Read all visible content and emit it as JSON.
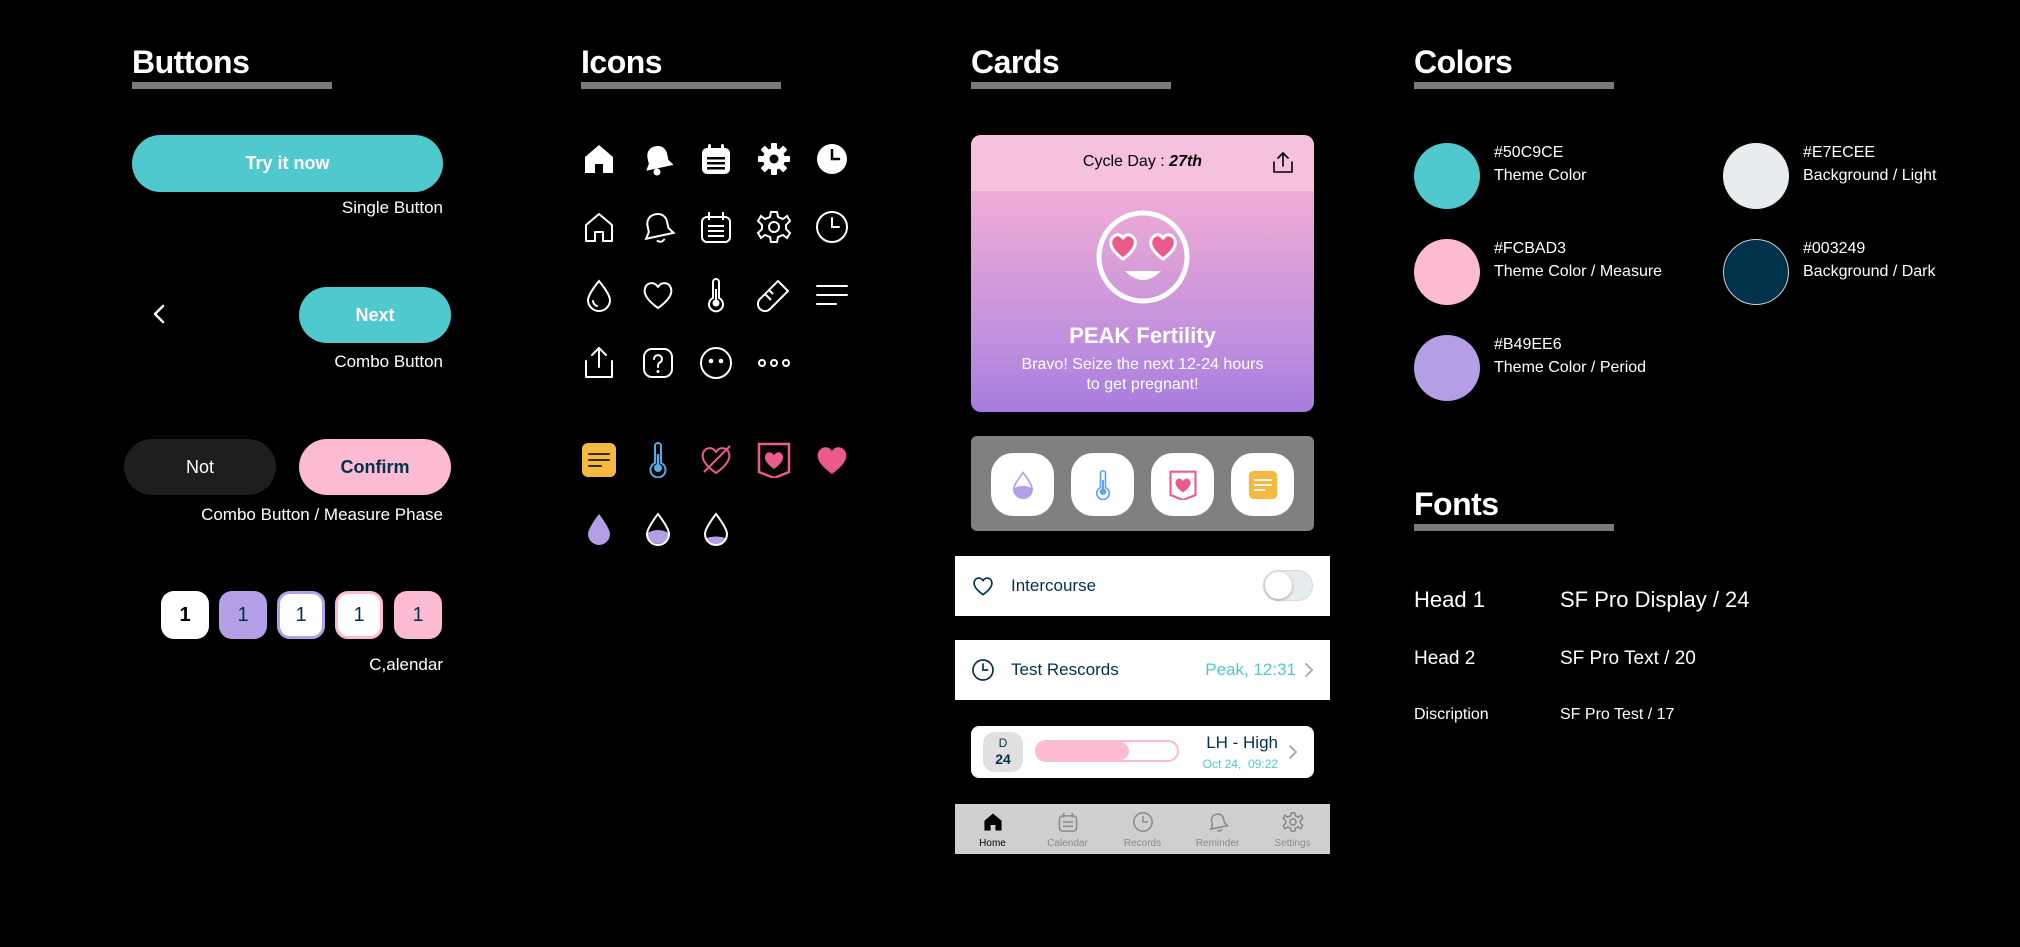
{
  "buttons": {
    "title": "Buttons",
    "single": {
      "label": "Try it now",
      "caption": "Single Button"
    },
    "combo": {
      "back_icon": "chevron-left-icon",
      "label": "Next",
      "caption": "Combo Button"
    },
    "measure": {
      "not_label": "Not",
      "confirm_label": "Confirm",
      "caption": "Combo Button / Measure Phase"
    },
    "calendar": {
      "days": [
        "1",
        "1",
        "1",
        "1",
        "1"
      ],
      "caption": "C,alendar"
    }
  },
  "icons": {
    "title": "Icons",
    "rows": [
      [
        "home-filled-icon",
        "bell-filled-icon",
        "calendar-filled-icon",
        "gear-filled-icon",
        "clock-filled-icon"
      ],
      [
        "home-outline-icon",
        "bell-outline-icon",
        "calendar-outline-icon",
        "gear-outline-icon",
        "clock-outline-icon"
      ],
      [
        "drop-icon",
        "heart-icon",
        "thermometer-icon",
        "test-tube-icon",
        "menu-icon"
      ],
      [
        "share-icon",
        "help-icon",
        "face-icon",
        "more-icon"
      ]
    ],
    "colored_rows": [
      [
        "note-yellow-icon",
        "thermometer-blue-icon",
        "heart-slash-pink-icon",
        "heart-badge-pink-icon",
        "heart-pink-icon"
      ],
      [
        "drop-full-purple-icon",
        "drop-half-purple-icon",
        "drop-low-purple-icon"
      ]
    ]
  },
  "cards": {
    "title": "Cards",
    "cycle": {
      "prefix": "Cycle Day : ",
      "day": "27th",
      "share_icon": "share-icon",
      "emoji": "heart-eyes-face-icon",
      "headline": "PEAK Fertility",
      "message_line1": "Bravo! Seize the next 12-24 hours",
      "message_line2": "to get pregnant!"
    },
    "quick_actions": [
      "drop-half-icon",
      "thermometer-icon",
      "heart-badge-icon",
      "note-icon"
    ],
    "intercourse": {
      "icon": "heart-outline-icon",
      "label": "Intercourse",
      "toggle_on": false
    },
    "test_records": {
      "icon": "clock-outline-icon",
      "label": "Test Rescords",
      "value": "Peak, 12:31"
    },
    "lh": {
      "day_letter": "D",
      "day_number": "24",
      "level_label": "LH - High",
      "date": "Oct 24,  09:22",
      "progress": 0.66
    },
    "tabbar": [
      {
        "icon": "home-icon",
        "label": "Home",
        "active": true
      },
      {
        "icon": "calendar-icon",
        "label": "Calendar",
        "active": false
      },
      {
        "icon": "clock-icon",
        "label": "Records",
        "active": false
      },
      {
        "icon": "bell-icon",
        "label": "Reminder",
        "active": false
      },
      {
        "icon": "gear-icon",
        "label": "Settings",
        "active": false
      }
    ]
  },
  "colors": {
    "title": "Colors",
    "items": [
      {
        "hex": "#50C9CE",
        "name": "Theme Color"
      },
      {
        "hex": "#E7ECEE",
        "name": "Background / Light"
      },
      {
        "hex": "#FCBAD3",
        "name": "Theme Color / Measure"
      },
      {
        "hex": "#003249",
        "name": "Background / Dark"
      },
      {
        "hex": "#B49EE6",
        "name": "Theme Color / Period"
      }
    ]
  },
  "fonts": {
    "title": "Fonts",
    "items": [
      {
        "name": "Head 1",
        "spec": "SF Pro Display / 24"
      },
      {
        "name": "Head 2",
        "spec": "SF Pro Text / 20"
      },
      {
        "name": "Discription",
        "spec": "SF Pro Test / 17"
      }
    ]
  },
  "palette": {
    "teal": "#50C9CE",
    "pink": "#FCBAD3",
    "purple": "#B49EE6",
    "dark": "#003249",
    "light": "#E7ECEE",
    "yellow": "#F4B940",
    "blue": "#5AA9E6",
    "hotpink": "#EB5A8C"
  }
}
